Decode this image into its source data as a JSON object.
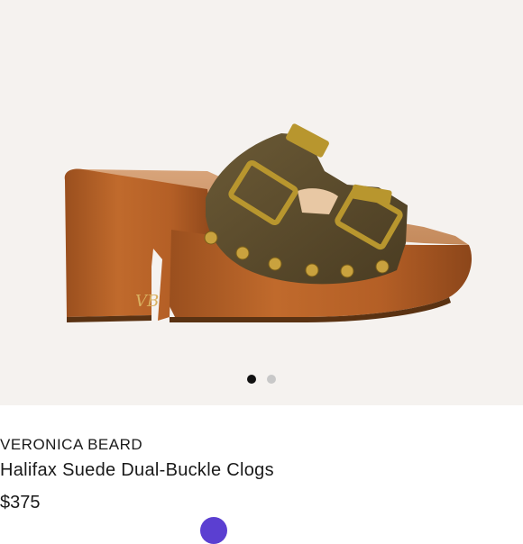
{
  "product": {
    "brand": "VERONICA BEARD",
    "title": "Halifax Suede Dual-Buckle Clogs",
    "price": "$375",
    "image_icon": "clog-sandal-image"
  },
  "carousel": {
    "total": 2,
    "active_index": 0
  },
  "colors": {
    "image_background": "#f5f2ef",
    "suede": "#5a4a2b",
    "wood": "#b8642a",
    "hardware": "#b8962e",
    "accent": "#5b3fd1"
  }
}
